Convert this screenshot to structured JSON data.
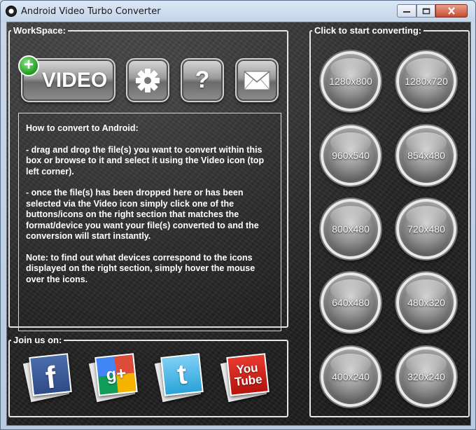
{
  "window": {
    "title": "Android Video Turbo Converter"
  },
  "workspace": {
    "legend": "WorkSpace:",
    "video_button_label": "VIDEO",
    "video_badge": "+",
    "help_glyph": "?",
    "info": {
      "heading": "How to convert to Android:",
      "step1": "- drag and drop the file(s) you want to convert within this box or browse to it and select it using the Video icon (top left corner).",
      "step2": "- once the file(s) has been dropped here or has been selected via the Video icon simply click one of the buttons/icons on the right section that matches the format/device you want your file(s) converted to and the conversion will start instantly.",
      "note": "Note: to find out what devices correspond to the icons displayed on the right section, simply hover the mouse over the icons."
    }
  },
  "join": {
    "legend": "Join us on:",
    "facebook_glyph": "f",
    "googleplus_glyph": "g+",
    "twitter_glyph": "t",
    "youtube_line1": "You",
    "youtube_line2": "Tube"
  },
  "convert": {
    "legend": "Click to start converting:",
    "resolutions": [
      "1280x800",
      "1280x720",
      "960x540",
      "854x480",
      "800x480",
      "720x480",
      "640x480",
      "480x320",
      "400x240",
      "320x240"
    ]
  },
  "icons": {
    "app": "film-reel-icon",
    "settings": "gear-icon",
    "help": "question-mark-icon",
    "mail": "envelope-icon",
    "facebook": "facebook-icon",
    "googleplus": "google-plus-icon",
    "twitter": "twitter-icon",
    "youtube": "youtube-icon"
  }
}
